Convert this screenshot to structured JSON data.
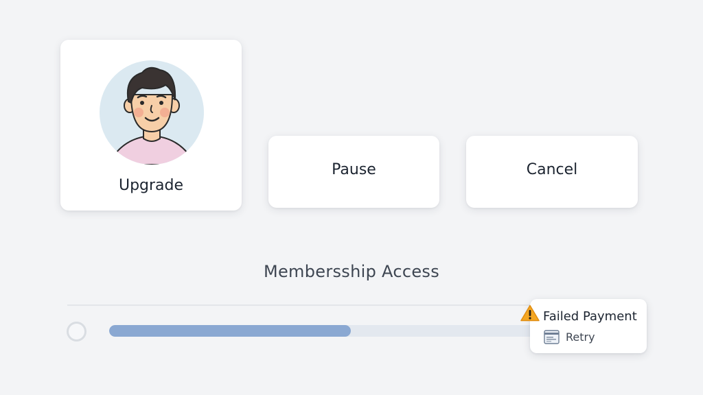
{
  "actions": {
    "upgrade_label": "Upgrade",
    "pause_label": "Pause",
    "cancel_label": "Cancel"
  },
  "section": {
    "title": "Membersship Access"
  },
  "progress": {
    "value": 0.55
  },
  "alert": {
    "title": "Failed Payment",
    "retry_label": "Retry",
    "icon": "warning-icon",
    "retry_icon": "card-icon"
  },
  "colors": {
    "background": "#f3f4f6",
    "progress_fill": "#8aa8d2",
    "progress_track": "#e3e8ef",
    "warning": "#f4a622"
  }
}
